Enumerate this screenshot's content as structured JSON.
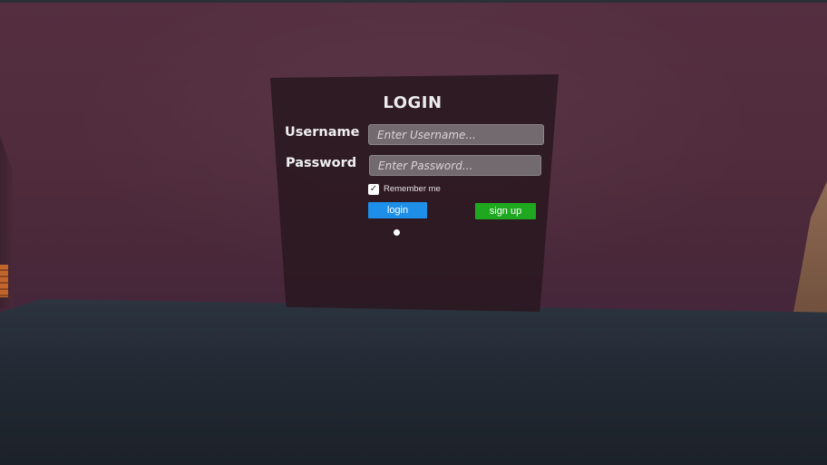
{
  "login_panel": {
    "title": "LOGIN",
    "username_label": "Username",
    "username_placeholder": "Enter Username...",
    "username_value": "",
    "password_label": "Password",
    "password_placeholder": "Enter Password...",
    "password_value": "",
    "remember_me": {
      "label": "Remember me",
      "checked": true,
      "check_glyph": "✓"
    },
    "login_button": "login",
    "signup_button": "sign up"
  },
  "colors": {
    "login_button": "#1e8fe8",
    "signup_button": "#1fa81f",
    "panel_background": "#2a1820",
    "wall": "#4f2b3b",
    "floor": "#222832"
  }
}
